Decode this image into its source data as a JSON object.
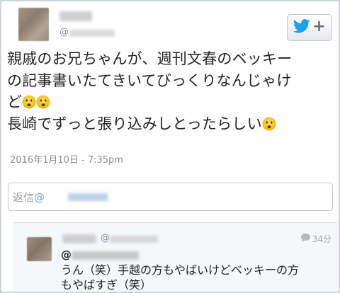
{
  "tweet": {
    "handle_prefix": "@",
    "lines": [
      "親戚のお兄ちゃんが、週刊文春のベッキー",
      "の記事書いたてきいてびっくりなんじゃけ",
      "ど",
      "長崎でずっと張り込みしとったらしい"
    ],
    "emoji_name": "frowning-face-icon",
    "timestamp": "2016年1月10日 - 7:35pm"
  },
  "follow_button": {
    "icon": "twitter-bird-icon",
    "plus": "+",
    "accent_color": "#1da1f2"
  },
  "reply_box": {
    "label": "返信",
    "at": "@"
  },
  "reply": {
    "handle_prefix": "@",
    "reply_icon": "speech-bubble-icon",
    "time": "34分",
    "mention_prefix": "@",
    "lines": [
      "うん（笑）手越の方もやばいけどベッキーの方",
      "もやばすぎ（笑）"
    ]
  }
}
